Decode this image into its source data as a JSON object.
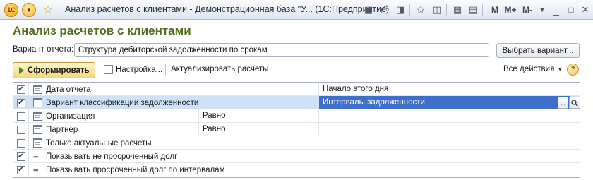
{
  "window": {
    "title": "Анализ расчетов с клиентами - Демонстрационная база \"У... (1С:Предприятие)",
    "logo_text": "1С",
    "toolbar_m": "M",
    "toolbar_m_plus": "M+",
    "toolbar_m_minus": "M-"
  },
  "page": {
    "title": "Анализ расчетов с клиентами"
  },
  "variant": {
    "label": "Вариант отчета:",
    "value": "Структура дебиторской задолженности по срокам",
    "choose_button": "Выбрать вариант..."
  },
  "commands": {
    "generate": "Сформировать",
    "settings": "Настройка...",
    "refresh": "Актуализировать расчеты",
    "all_actions": "Все действия",
    "help": "?"
  },
  "grid": {
    "rows": [
      {
        "checked": true,
        "icon": "calendar-icon",
        "name": "Дата отчета",
        "condition": "",
        "value": "Начало этого дня"
      },
      {
        "checked": true,
        "icon": "calendar-icon",
        "name": "Вариант классификации задолженности",
        "condition": "",
        "value": "Интервалы задолженности",
        "selected": true
      },
      {
        "checked": false,
        "icon": "calendar-icon",
        "name": "Организация",
        "condition": "Равно",
        "value": ""
      },
      {
        "checked": false,
        "icon": "calendar-icon",
        "name": "Партнер",
        "condition": "Равно",
        "value": ""
      },
      {
        "checked": false,
        "icon": "calendar-icon",
        "name": "Только актуальные расчеты",
        "condition": "",
        "value": ""
      },
      {
        "checked": true,
        "icon": "dots-icon",
        "name": "Показывать не просроченный долг",
        "condition": "",
        "value": ""
      },
      {
        "checked": true,
        "icon": "dots-icon",
        "name": "Показывать просроченный долг по интервалам",
        "condition": "",
        "value": ""
      }
    ],
    "selected_field_buttons": [
      "...",
      "search-icon"
    ]
  },
  "colors": {
    "accent_title": "#4d6e1c",
    "selection": "#3d6fcb",
    "row_highlight": "#cfe1f6"
  }
}
